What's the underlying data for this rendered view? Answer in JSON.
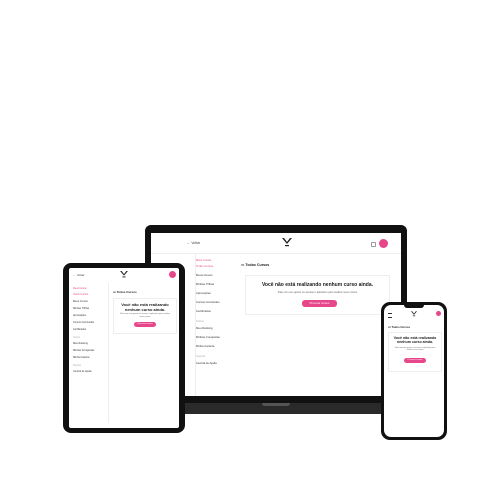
{
  "topbar": {
    "back_label": "Voltar",
    "avatar_initial": ""
  },
  "page": {
    "title": "Todos Cursos",
    "empty_heading": "Você não está realizando nenhum curso ainda.",
    "empty_heading_phone": "Você não está realizando nenhum curso ainda.",
    "empty_sub": "Fale com seu gestor ou acesse o aplicativo para realizar seus cursos",
    "cta_label": "Procurar cursos"
  },
  "sidebar": {
    "section_main": "Meus Cursos",
    "items": [
      {
        "label": "Todos Cursos",
        "active": true
      },
      {
        "label": "Meus Cursos"
      },
      {
        "label": "Minhas Trilhas"
      },
      {
        "label": "Aprovações"
      },
      {
        "label": "Cursos Concluídos"
      },
      {
        "label": "Certificados"
      }
    ],
    "section_extra": "Outros",
    "items_extra": [
      {
        "label": "Meu Ranking"
      },
      {
        "label": "Minhas Conquistas"
      },
      {
        "label": "Minha Carteira"
      }
    ],
    "section_help": "Suporte",
    "items_help": [
      {
        "label": "Central de Ajuda"
      }
    ]
  },
  "colors": {
    "accent": "#e6478a",
    "device_frame": "#111111",
    "laptop_base": "#2a2a2a"
  }
}
